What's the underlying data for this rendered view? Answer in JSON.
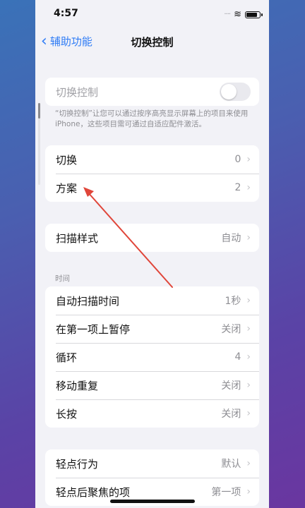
{
  "status_bar": {
    "time": "4:57",
    "signal_glyph": "····",
    "wifi_glyph": "≋",
    "icons": [
      "signal-icon",
      "wifi-icon",
      "battery-icon"
    ]
  },
  "nav": {
    "back_label": "辅助功能",
    "title": "切换控制"
  },
  "switch_control": {
    "label": "切换控制",
    "enabled": false,
    "note": "“切换控制”让您可以通过按序高亮显示屏幕上的项目来使用iPhone，这些项目需可通过自适应配件激活。"
  },
  "group_switches": [
    {
      "label": "切换",
      "value": "0"
    },
    {
      "label": "方案",
      "value": "2"
    }
  ],
  "group_scan": [
    {
      "label": "扫描样式",
      "value": "自动"
    }
  ],
  "timing": {
    "header": "时间",
    "rows": [
      {
        "label": "自动扫描时间",
        "value": "1秒"
      },
      {
        "label": "在第一项上暂停",
        "value": "关闭"
      },
      {
        "label": "循环",
        "value": "4"
      },
      {
        "label": "移动重复",
        "value": "关闭"
      },
      {
        "label": "长按",
        "value": "关闭"
      }
    ]
  },
  "tap": [
    {
      "label": "轻点行为",
      "value": "默认"
    },
    {
      "label": "轻点后聚焦的项",
      "value": "第一项"
    }
  ],
  "chevron": "›",
  "annotation_color": "#e0463a"
}
